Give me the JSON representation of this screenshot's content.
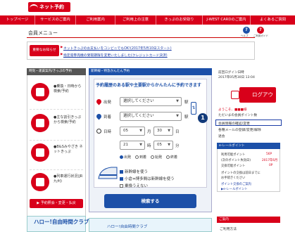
{
  "header": {
    "logo": "ネット予約",
    "nav": [
      "トップページ",
      "サービスのご案内",
      "ご利用案内",
      "ご利用上の注意",
      "きっぷのお受取り",
      "J-WEST CARDのご案内",
      "よくあるご質問"
    ]
  },
  "page": {
    "title": "会員メニュー",
    "top_icons": [
      {
        "label": "ヘルプ",
        "glyph": "?"
      },
      {
        "label": "ご利用ガイド",
        "glyph": "?"
      }
    ]
  },
  "notice": {
    "badge": "重要なお知らせ",
    "links": [
      "ネットきっぷのお支払いをコンビニでもOK!(2017年5月10日スタート)",
      "指定席券売機の受取期限を変更いたしました(クレジットカード決済)"
    ]
  },
  "left": {
    "heading": "時刻・運賃案内/きっぷの予約",
    "items": [
      {
        "label": "●乗換・日時から検索/予約",
        "icon": "train-ticket-icon"
      },
      {
        "label": "●主な割引きっぷから検索/予約",
        "icon": "discount-ticket-icon"
      },
      {
        "label": "●B&Sみやざき ネットきっぷ",
        "icon": "bus-icon"
      },
      {
        "label": "●列車運行状況(JR九州)",
        "icon": "train-icon"
      }
    ],
    "button": "▶ 予約照会・変更・払戻",
    "banner_title": "ハロー!自由時間クラブ",
    "banner_sub": "ハロー!自由時間クラブ"
  },
  "search": {
    "heading": "新幹線・特急かんたん予約",
    "lead": "予約履歴のある駅や主要駅からかんたんに予約できます",
    "from_label": "出発",
    "to_label": "到着",
    "date_label": "日時",
    "from_value": "選択してください",
    "to_value": "選択してください",
    "station_unit": "駅",
    "month": "05",
    "month_unit": "月",
    "day": "30",
    "day_unit": "日",
    "hour": "21",
    "hour_unit": "時",
    "minute": "05",
    "minute_unit": "分",
    "time_modes": [
      "出発",
      "到着",
      "始発",
      "終着"
    ],
    "selected_mode": "出発",
    "options": [
      {
        "label": "新幹線を使う",
        "checked": true
      },
      {
        "label": "小倉⇔博多間は新幹線を使う",
        "checked": true
      },
      {
        "label": "乗換うえない",
        "checked": false
      }
    ],
    "submit": "検索する",
    "banner": "ハロー!自由時間クラブ"
  },
  "account": {
    "last_login_label": "前回ログイン日時",
    "last_login_line2": "2017年05月30日 13:04",
    "logout": "ログアウト",
    "greeting": "ようこそ、■■■様",
    "greeting_sub": "ただいまの会員ポイント数",
    "links": [
      "会員情報の確認/変更",
      "各種メールの登録/変更/解除",
      "退会"
    ],
    "highlight_marker": "1"
  },
  "points": {
    "heading": "e-レールポイント",
    "rows": [
      {
        "label": "利用可能ポイント",
        "value": "56P"
      },
      {
        "label": "(次のポイント失効日)",
        "value": "2017年6月"
      },
      {
        "label": "交換可能ポイント",
        "value": "0P"
      }
    ],
    "notes": [
      "ポイントの交換は前日までに",
      "お手続きください",
      "ポイント交換のご案内",
      "▶e-レールポイント"
    ]
  },
  "help": {
    "heading": "ご案内",
    "item": "ご利用方法"
  },
  "colors": {
    "brand_red": "#d8001a",
    "accent_blue": "#1c50a8"
  }
}
